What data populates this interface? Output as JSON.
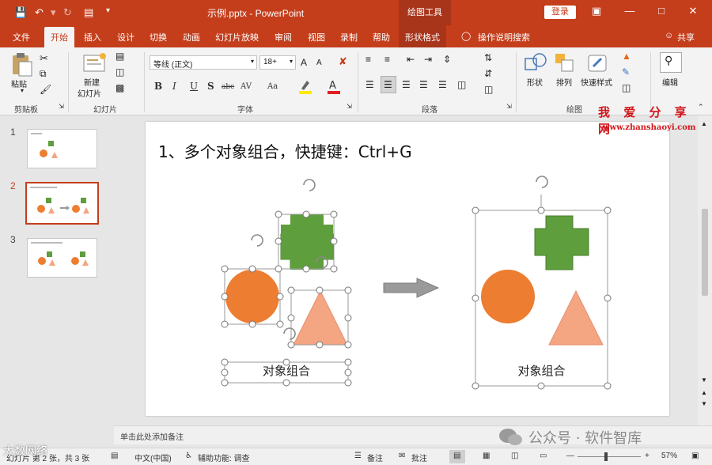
{
  "titlebar": {
    "doc_title": "示例.pptx  -  PowerPoint",
    "context_tool": "绘图工具",
    "login": "登录",
    "save_icon": "save-icon",
    "undo_icon": "undo-icon",
    "redo_icon": "redo-icon"
  },
  "tabs": [
    "文件",
    "开始",
    "插入",
    "设计",
    "切换",
    "动画",
    "幻灯片放映",
    "审阅",
    "视图",
    "录制",
    "帮助",
    "形状格式"
  ],
  "tell_me": "操作说明搜索",
  "share": "共享",
  "ribbon": {
    "paste": "粘贴",
    "clipboard": "剪贴板",
    "new_slide": "新建\n幻灯片",
    "new_slide_l1": "新建",
    "new_slide_l2": "幻灯片",
    "slides": "幻灯片",
    "font_name": "等线 (正文)",
    "font_size": "18+",
    "font": "字体",
    "paragraph": "段落",
    "shape": "形状",
    "arrange": "排列",
    "quick_styles": "快速样式",
    "drawing": "绘图",
    "edit": "编辑",
    "fmt_bold": "B",
    "fmt_italic": "I",
    "fmt_underline": "U",
    "fmt_shadow": "S",
    "fmt_strike": "abc",
    "fmt_spacing": "AV",
    "fmt_case": "Aa",
    "grow": "A",
    "shrink": "A"
  },
  "slide": {
    "title": "1、多个对象组合，快捷键：Ctrl+G",
    "label_left": "对象组合",
    "label_right": "对象组合"
  },
  "thumbnails": [
    "1",
    "2",
    "3"
  ],
  "notes_placeholder": "单击此处添加备注",
  "status": {
    "slide_info": "幻灯片 第 2 张，共 3 张",
    "language": "中文(中国)",
    "accessibility": "辅助功能: 调查",
    "notes": "备注",
    "comments": "批注",
    "zoom": "57%"
  },
  "watermarks": {
    "site_name": "我 爱 分 享 网",
    "site_url": "www.zhanshaoyi.com",
    "gzh": "公众号 · 软件智库",
    "corner": "大数网络"
  },
  "colors": {
    "accent": "#c43e1c",
    "orange": "#ed7d31",
    "green": "#5e9e3c",
    "salmon": "#f4a582",
    "arrow": "#9a9a9a"
  }
}
